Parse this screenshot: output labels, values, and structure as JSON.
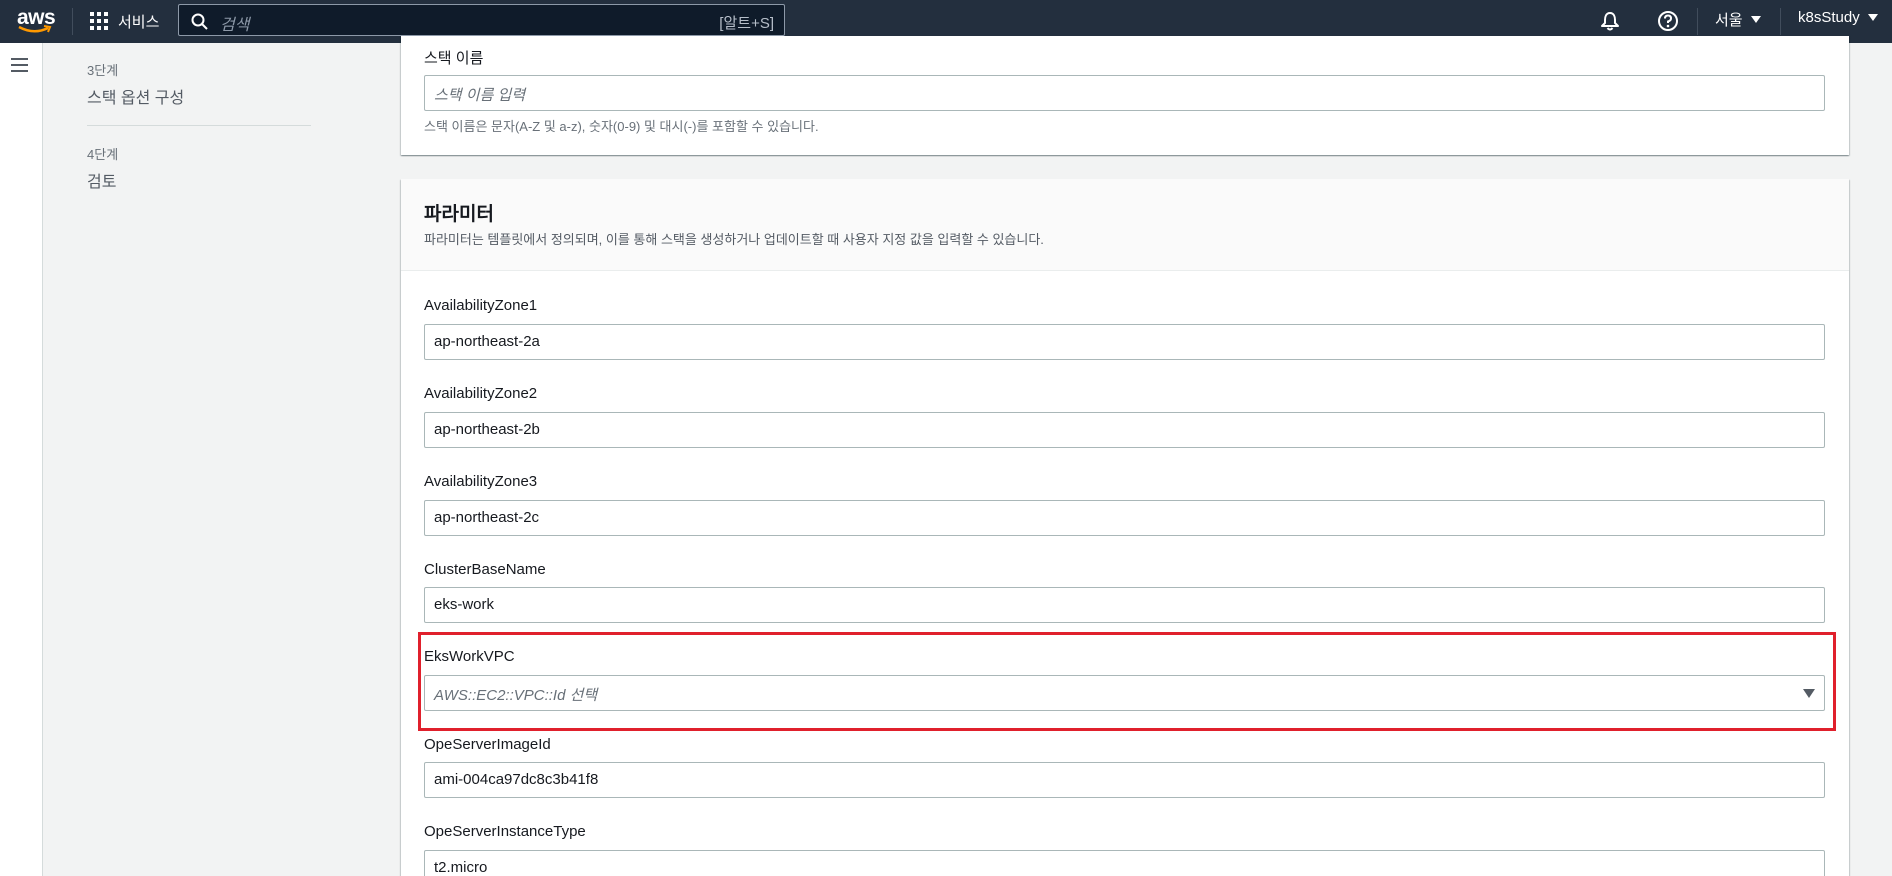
{
  "nav": {
    "logo": "aws",
    "services_label": "서비스",
    "search_placeholder": "검색",
    "search_shortcut": "[알트+S]",
    "region_label": "서울",
    "account_label": "k8sStudy"
  },
  "steps": [
    {
      "label": "3단계",
      "title": "스택 옵션 구성"
    },
    {
      "label": "4단계",
      "title": "검토"
    }
  ],
  "stack_name": {
    "label": "스택 이름",
    "placeholder": "스택 이름 입력",
    "hint": "스택 이름은 문자(A-Z 및 a-z), 숫자(0-9) 및 대시(-)를 포함할 수 있습니다."
  },
  "parameters": {
    "title": "파라미터",
    "description": "파라미터는 템플릿에서 정의되며, 이를 통해 스택을 생성하거나 업데이트할 때 사용자 지정 값을 입력할 수 있습니다.",
    "fields": [
      {
        "label": "AvailabilityZone1",
        "value": "ap-northeast-2a"
      },
      {
        "label": "AvailabilityZone2",
        "value": "ap-northeast-2b"
      },
      {
        "label": "AvailabilityZone3",
        "value": "ap-northeast-2c"
      },
      {
        "label": "ClusterBaseName",
        "value": "eks-work"
      },
      {
        "label": "EksWorkVPC",
        "placeholder": "AWS::EC2::VPC::Id 선택"
      },
      {
        "label": "OpeServerImageId",
        "value": "ami-004ca97dc8c3b41f8"
      },
      {
        "label": "OpeServerInstanceType",
        "value": "t2.micro"
      }
    ]
  },
  "colors": {
    "nav_bg": "#232f3e",
    "highlight": "#e0202c"
  },
  "icons": [
    "aws-logo",
    "services-grid-icon",
    "search-icon",
    "bell-icon",
    "help-icon",
    "caret-down-icon",
    "menu-icon",
    "select-arrow-icon"
  ]
}
